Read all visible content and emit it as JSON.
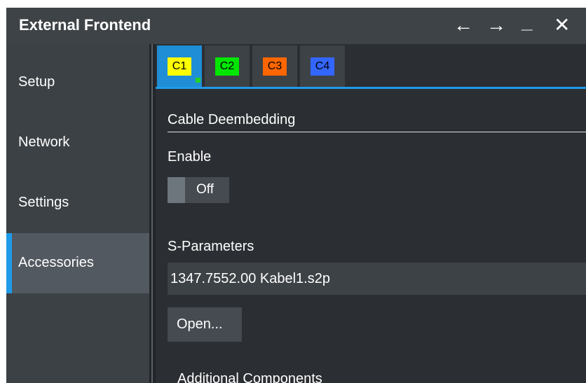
{
  "window": {
    "title": "External Frontend",
    "controls": {
      "back": "←",
      "forward": "→",
      "minimize": "_",
      "close": "✕"
    }
  },
  "sidebar": {
    "items": [
      {
        "label": "Setup",
        "active": false
      },
      {
        "label": "Network",
        "active": false
      },
      {
        "label": "Settings",
        "active": false
      },
      {
        "label": "Accessories",
        "active": true
      }
    ]
  },
  "tabs": [
    {
      "label": "C1",
      "color": "#ffff00",
      "active": true
    },
    {
      "label": "C2",
      "color": "#00e600",
      "active": false
    },
    {
      "label": "C3",
      "color": "#ff6600",
      "active": false
    },
    {
      "label": "C4",
      "color": "#3366ff",
      "active": false
    }
  ],
  "main": {
    "section_title": "Cable Deembedding",
    "enable_label": "Enable",
    "enable_state": "Off",
    "s_params_label": "S-Parameters",
    "s_params_file": "1347.7552.00 Kabel1.s2p",
    "open_button": "Open...",
    "additional_label": "Additional Components"
  },
  "colors": {
    "accent": "#1f9ae8",
    "titlebar": "#3e4347",
    "sidebar": "#3c4145",
    "panel": "#2b2f33"
  }
}
